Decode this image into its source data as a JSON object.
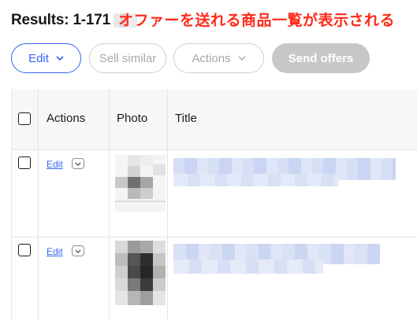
{
  "header": {
    "results_label": "Results: 1-171",
    "annotation": "オファーを送れる商品一覧が表示される"
  },
  "toolbar": {
    "edit_label": "Edit",
    "sell_similar_label": "Sell similar",
    "actions_label": "Actions",
    "send_offers_label": "Send offers"
  },
  "table": {
    "columns": [
      "Actions",
      "Photo",
      "Title"
    ],
    "rows": [
      {
        "edit_label": "Edit"
      },
      {
        "edit_label": "Edit"
      }
    ]
  },
  "colors": {
    "primary_blue": "#3665f3",
    "annotation_red": "#ff2a1a",
    "disabled_gray": "#c7c7c7"
  },
  "icons": [
    "chevron-down-icon",
    "checkbox-icon"
  ]
}
